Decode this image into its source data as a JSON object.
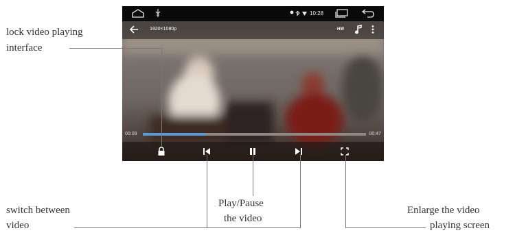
{
  "status_bar": {
    "time": "10:28",
    "icons": [
      "home-icon",
      "usb-icon",
      "location-icon",
      "bluetooth-icon",
      "wifi-icon",
      "recent-apps-icon",
      "back-icon"
    ]
  },
  "title_bar": {
    "resolution": "1920×1080p",
    "hw_badge": "HW",
    "icons": [
      "back-arrow-icon",
      "music-note-icon",
      "more-vert-icon"
    ]
  },
  "playback": {
    "elapsed": "00:09",
    "total": "00:47",
    "progress": 0.28
  },
  "controls": [
    "lock-icon",
    "previous-icon",
    "pause-icon",
    "next-icon",
    "fullscreen-icon"
  ],
  "annotations": {
    "lock_line1": "lock video playing",
    "lock_line2": "interface",
    "switch_line1": "switch between",
    "switch_line2": "video",
    "play_line1": "Play/Pause",
    "play_line2": "the video",
    "enlarge_line1": "Enlarge the video",
    "enlarge_line2": "playing screen"
  },
  "colors": {
    "progress_fill": "#5a9bd6",
    "status_bar_bg": "#000000"
  }
}
